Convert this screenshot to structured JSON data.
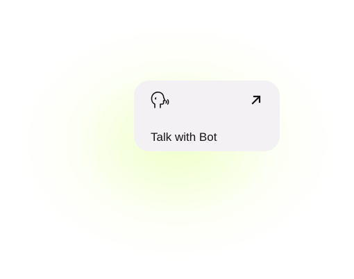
{
  "card": {
    "label": "Talk with Bot",
    "leading_icon": "talking-head-icon",
    "trailing_icon": "arrow-up-right-icon",
    "background_color": "#f3f1f3"
  },
  "background": {
    "glow_color": "#f0ffc8"
  }
}
